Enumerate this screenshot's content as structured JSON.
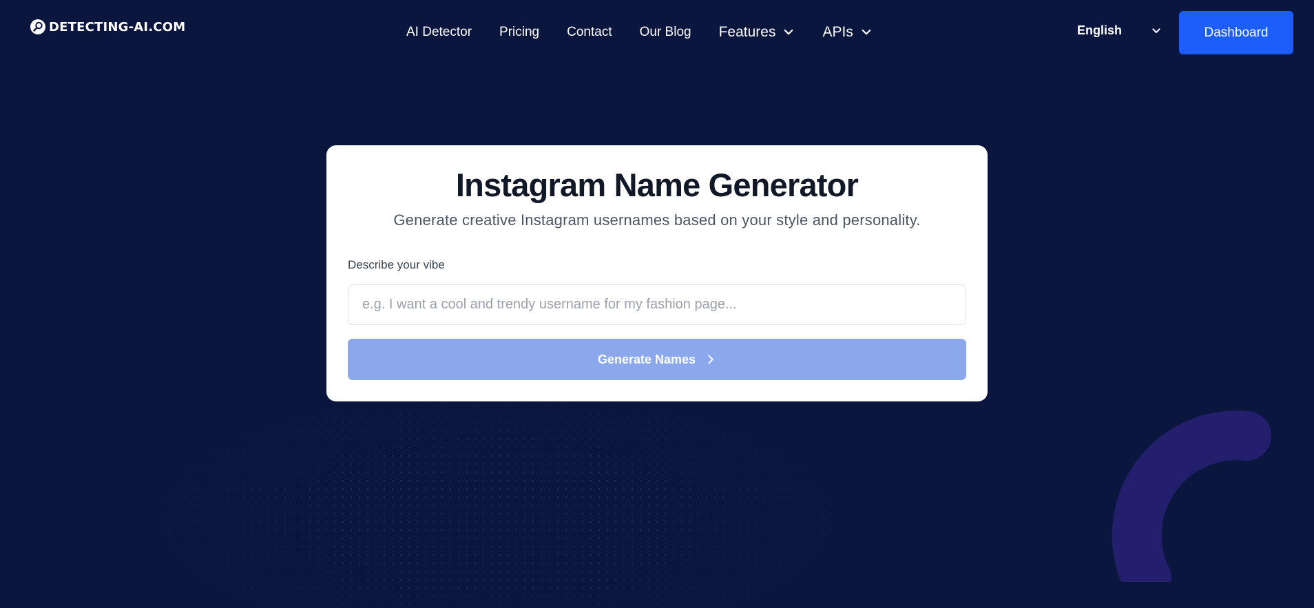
{
  "colors": {
    "background": "#0b163f",
    "accent": "#1d5efb",
    "button_disabled": "#8ca8ec",
    "arc": "#241f6d"
  },
  "header": {
    "logo_text": "DETECTING-AI.COM",
    "nav": [
      {
        "label": "AI Detector"
      },
      {
        "label": "Pricing"
      },
      {
        "label": "Contact"
      },
      {
        "label": "Our Blog"
      },
      {
        "label": "Features",
        "icon": "chevron-down-icon"
      },
      {
        "label": "APIs",
        "icon": "chevron-down-icon"
      }
    ],
    "language": "English",
    "dashboard_label": "Dashboard"
  },
  "card": {
    "title": "Instagram Name Generator",
    "subtitle": "Generate creative Instagram usernames based on your style and personality.",
    "field_label": "Describe your vibe",
    "input_value": "",
    "input_placeholder": "e.g. I want a cool and trendy username for my fashion page...",
    "button_label": "Generate Names",
    "button_icon": "chevron-right-icon"
  }
}
